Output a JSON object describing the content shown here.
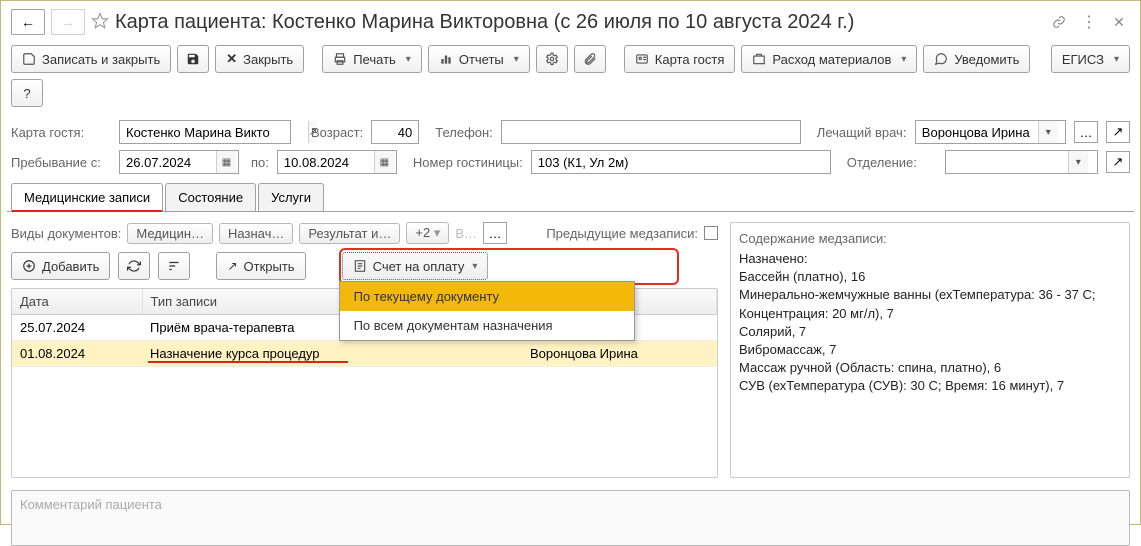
{
  "title": "Карта пациента: Костенко Марина Викторовна (с 26 июля по 10 августа 2024 г.)",
  "toolbar": {
    "save_close": "Записать и закрыть",
    "close": "Закрыть",
    "print": "Печать",
    "reports": "Отчеты",
    "guest_card": "Карта гостя",
    "materials": "Расход материалов",
    "notify": "Уведомить",
    "egisz": "ЕГИСЗ",
    "help": "?"
  },
  "form": {
    "guest_card_label": "Карта гостя:",
    "guest_name": "Костенко Марина Викто",
    "age_label": "Возраст:",
    "age": "40",
    "phone_label": "Телефон:",
    "phone": "",
    "doctor_label": "Лечащий врач:",
    "doctor": "Воронцова Ирина",
    "stay_from_label": "Пребывание с:",
    "stay_from": "26.07.2024",
    "stay_to_label": "по:",
    "stay_to": "10.08.2024",
    "hotel_label": "Номер гостиницы:",
    "hotel": "103 (К1, Ул 2м)",
    "dept_label": "Отделение:",
    "dept": ""
  },
  "tabs": {
    "t1": "Медицинские записи",
    "t2": "Состояние",
    "t3": "Услуги"
  },
  "docTypes": {
    "label": "Виды документов:",
    "chips": [
      "Медицин…",
      "Назнач…",
      "Результат и…",
      "+2"
    ],
    "prev_label": "Предыдущие медзаписи:"
  },
  "actions": {
    "add": "Добавить",
    "open": "Открыть",
    "invoice": "Счет на оплату",
    "menu_current": "По текущему документу",
    "menu_all": "По всем документам назначения"
  },
  "table": {
    "h_date": "Дата",
    "h_type": "Тип записи",
    "h_note": "",
    "h_resp": "",
    "rows": [
      {
        "date": "25.07.2024",
        "type": "Приём врача-терапевта",
        "note": "",
        "resp": ""
      },
      {
        "date": "01.08.2024",
        "type": "Назначение курса процедур",
        "note": "",
        "resp": "Воронцова Ирина"
      }
    ]
  },
  "side": {
    "title": "Содержание медзаписи:",
    "l1": "Назначено:",
    "l2": "Бассейн (платно), 16",
    "l3": "Минерально-жемчужные ванны (ехТемпература: 36 - 37 С; Концентрация: 20 мг/л), 7",
    "l4": "Солярий, 7",
    "l5": "Вибромассаж, 7",
    "l6": "Массаж ручной (Область: спина, платно), 6",
    "l7": "СУВ (ехТемпература (СУВ): 30 С; Время: 16 минут), 7"
  },
  "comment_placeholder": "Комментарий пациента"
}
